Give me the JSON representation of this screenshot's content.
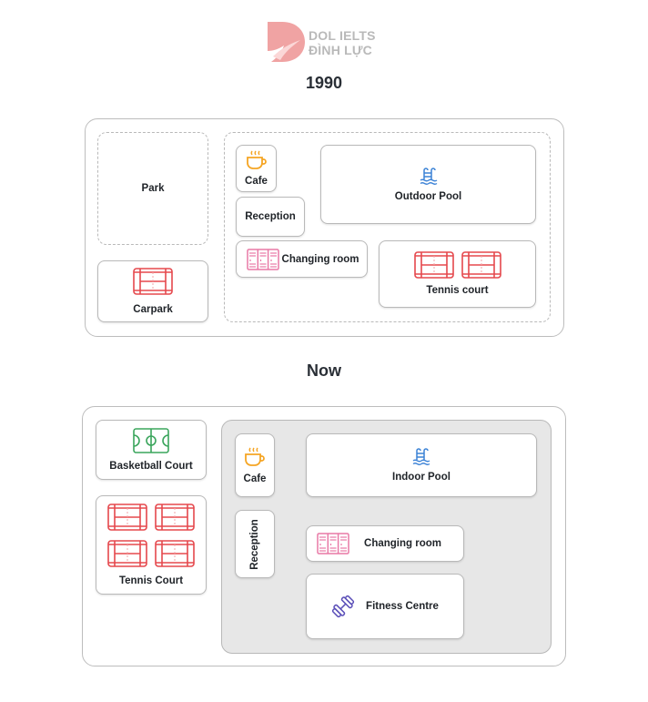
{
  "brand": {
    "line1": "DOL IELTS",
    "line2": "ĐÌNH LỰC",
    "color": "#ee9a9a"
  },
  "maps": [
    {
      "title": "1990",
      "facilities": {
        "park": {
          "label": "Park",
          "icon": null
        },
        "carpark": {
          "label": "Carpark",
          "icon": "court-icon"
        },
        "cafe": {
          "label": "Cafe",
          "icon": "coffee-cup-icon"
        },
        "reception": {
          "label": "Reception",
          "icon": null
        },
        "changing_room": {
          "label": "Changing room",
          "icon": "lockers-icon"
        },
        "outdoor_pool": {
          "label": "Outdoor Pool",
          "icon": "pool-ladder-icon"
        },
        "tennis_court": {
          "label": "Tennis court",
          "icon": "tennis-court-icon",
          "count": 2
        }
      }
    },
    {
      "title": "Now",
      "facilities": {
        "basketball_court": {
          "label": "Basketball Court",
          "icon": "basketball-court-icon"
        },
        "tennis_court": {
          "label": "Tennis Court",
          "icon": "tennis-court-icon",
          "count": 4
        },
        "cafe": {
          "label": "Cafe",
          "icon": "coffee-cup-icon"
        },
        "reception": {
          "label": "Reception",
          "icon": null
        },
        "indoor_pool": {
          "label": "Indoor Pool",
          "icon": "pool-ladder-icon"
        },
        "changing_room": {
          "label": "Changing room",
          "icon": "lockers-icon"
        },
        "fitness_centre": {
          "label": "Fitness Centre",
          "icon": "dumbbell-icon"
        }
      }
    }
  ],
  "colors": {
    "court": "#e5484d",
    "cafe": "#f5a524",
    "pool": "#3b82d6",
    "lockers": "#e879a6",
    "basketball": "#3aa55c",
    "fitness": "#5b4fb8"
  }
}
